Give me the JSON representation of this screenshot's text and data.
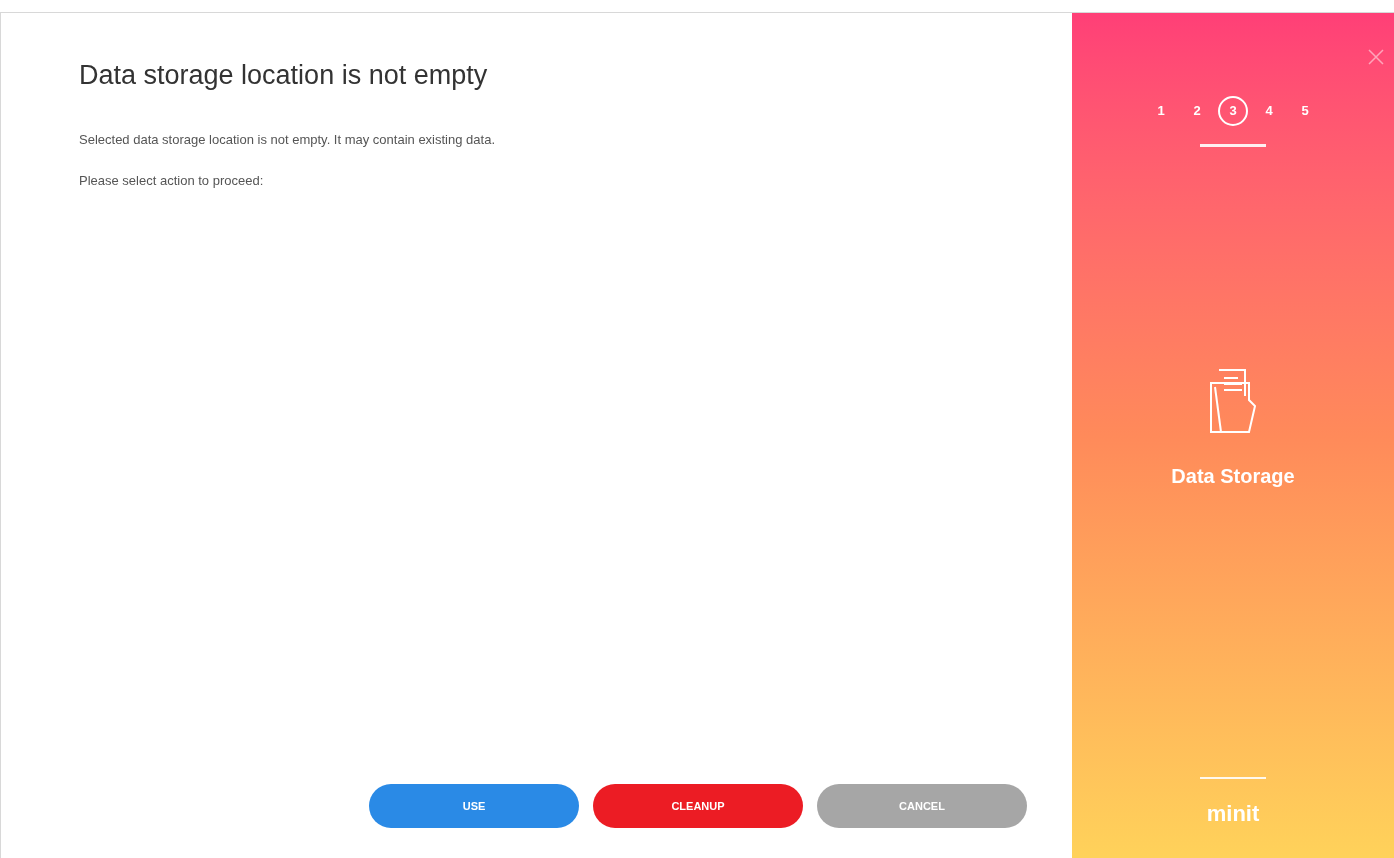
{
  "dialog": {
    "title": "Data storage location is not empty",
    "message": "Selected data storage location is not empty. It may contain existing data.",
    "prompt": "Please select action to proceed:"
  },
  "buttons": [
    {
      "label": "USE",
      "kind": "primary"
    },
    {
      "label": "CLEANUP",
      "kind": "danger"
    },
    {
      "label": "CANCEL",
      "kind": "neutral"
    }
  ],
  "sidebar": {
    "steps": [
      {
        "label": "1",
        "selected": false
      },
      {
        "label": "2",
        "selected": false
      },
      {
        "label": "3",
        "selected": true
      },
      {
        "label": "4",
        "selected": false
      },
      {
        "label": "5",
        "selected": false
      }
    ],
    "step_title": "Data Storage",
    "brand": "minit"
  }
}
